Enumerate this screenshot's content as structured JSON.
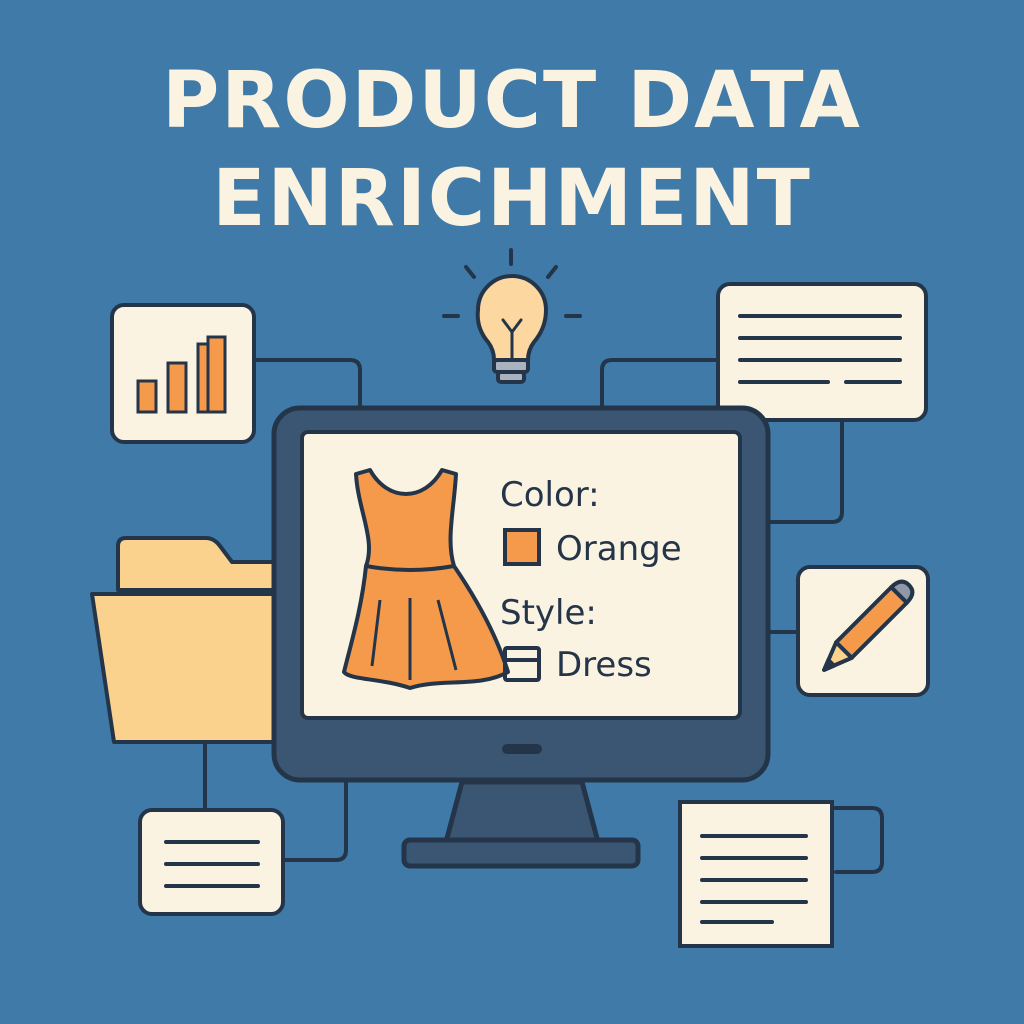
{
  "title": {
    "line1": "PRODUCT DATA",
    "line2": "ENRICHMENT"
  },
  "product": {
    "color_label": "Color:",
    "color_value": "Orange",
    "style_label": "Style:",
    "style_value": "Dress"
  },
  "colors": {
    "background": "#3f7aa8",
    "card": "#fbf3e1",
    "outline": "#243549",
    "accent_orange": "#f59a4a",
    "folder": "#fbd18e",
    "bulb": "#fcd7a0",
    "monitor_frame": "#3b5673"
  },
  "icons": {
    "top_left_card": "bar-chart-icon",
    "top_center": "lightbulb-icon",
    "top_right_card": "document-lines-icon",
    "left": "folder-icon",
    "right_card": "pencil-icon",
    "bottom_left_card": "text-lines-icon",
    "bottom_right_card": "document-icon",
    "center": "monitor-icon",
    "product": "dress-icon"
  }
}
